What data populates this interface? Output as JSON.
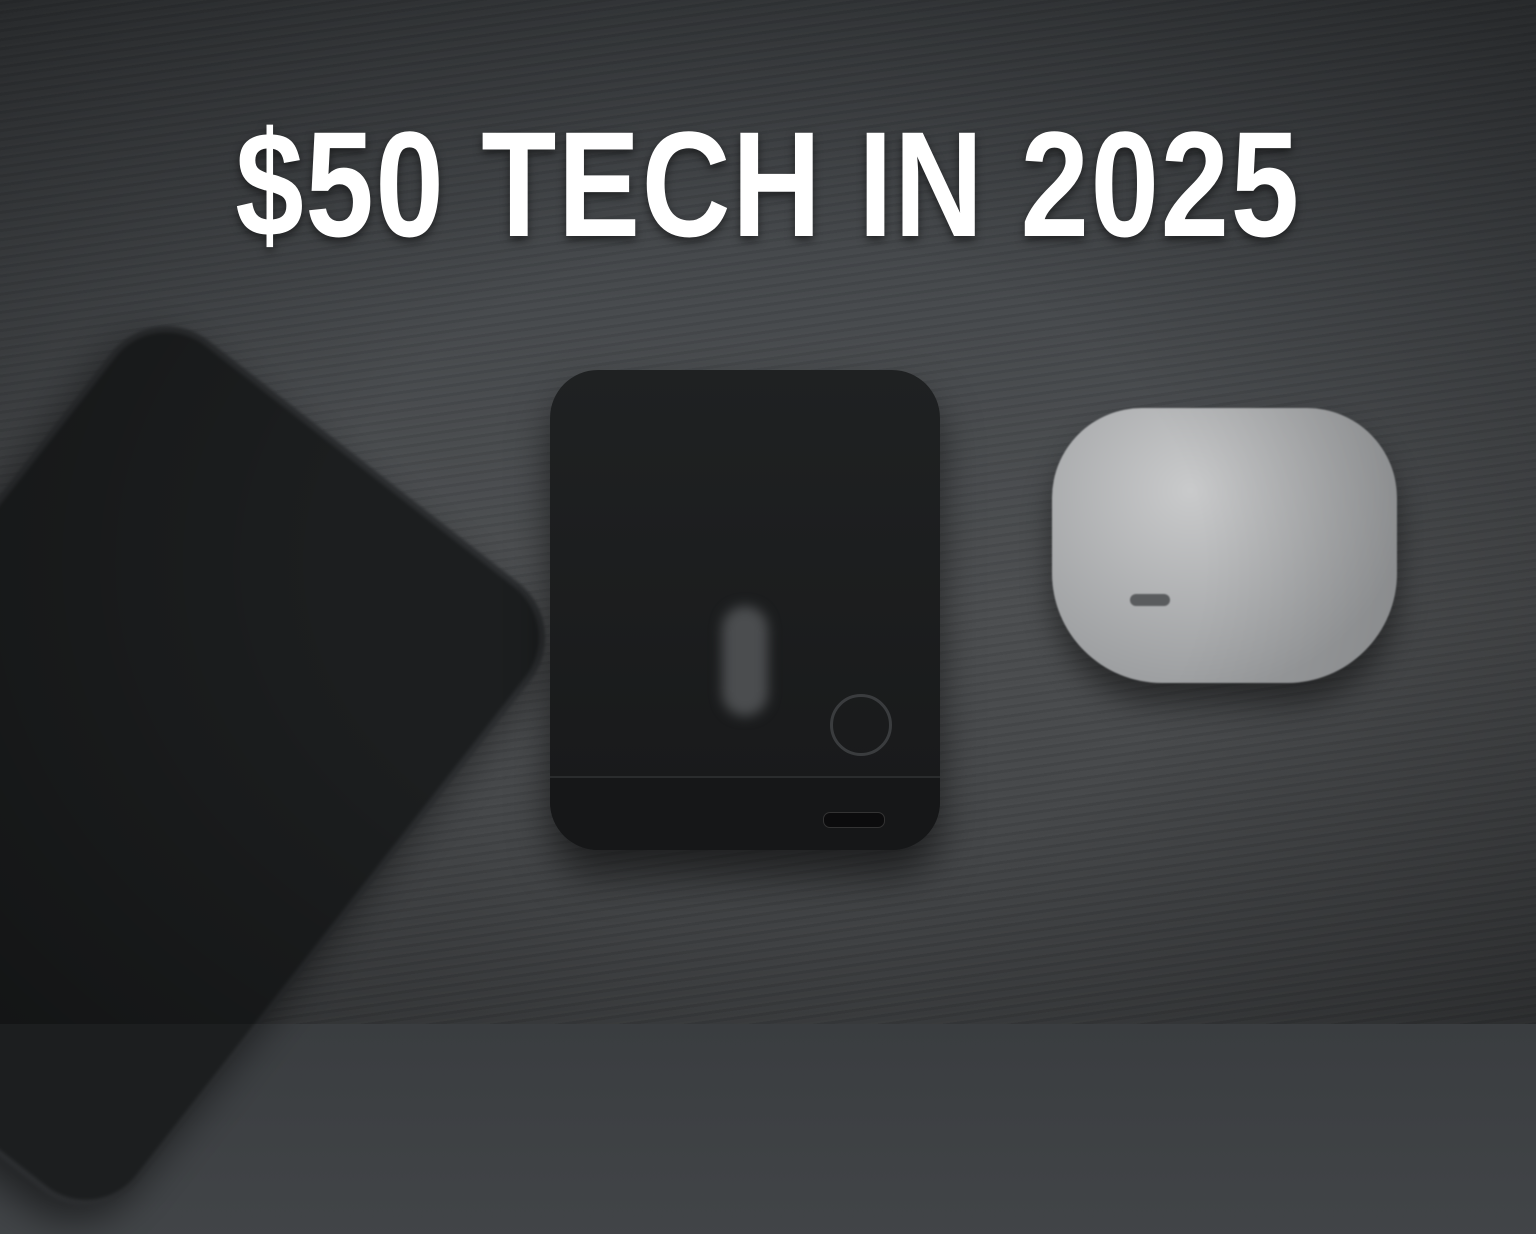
{
  "headline": "$50 TECH IN 2025"
}
